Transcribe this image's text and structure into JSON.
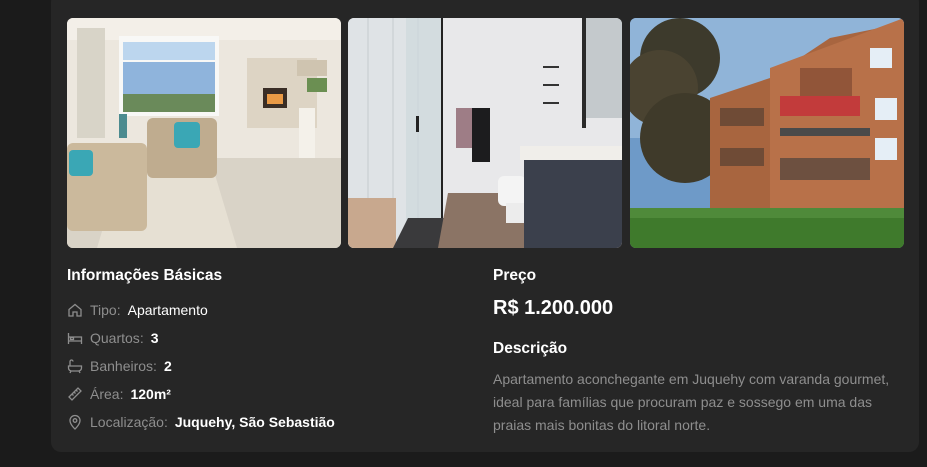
{
  "gallery": {
    "images": [
      {
        "alt": "living-room-photo"
      },
      {
        "alt": "bathroom-photo"
      },
      {
        "alt": "building-exterior-photo"
      }
    ]
  },
  "basic_info": {
    "title": "Informações Básicas",
    "rows": [
      {
        "icon": "home-icon",
        "label": "Tipo",
        "value": "Apartamento"
      },
      {
        "icon": "bed-icon",
        "label": "Quartos",
        "value": "3"
      },
      {
        "icon": "bath-icon",
        "label": "Banheiros",
        "value": "2"
      },
      {
        "icon": "ruler-icon",
        "label": "Área",
        "value": "120m²"
      },
      {
        "icon": "map-pin-icon",
        "label": "Localização",
        "value": "Juquehy, São Sebastião"
      }
    ]
  },
  "price": {
    "title": "Preço",
    "value": "R$ 1.200.000"
  },
  "description": {
    "title": "Descrição",
    "text": "Apartamento aconchegante em Juquehy com varanda gourmet, ideal para famílias que procuram paz e sossego em uma das praias mais bonitas do litoral norte."
  },
  "colors": {
    "page_bg": "#1b1b1b",
    "card_bg": "#262626",
    "label": "#8e8e8e",
    "value": "#ffffff"
  }
}
